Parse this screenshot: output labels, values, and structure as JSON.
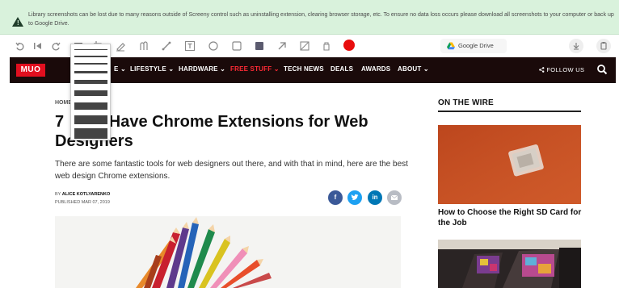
{
  "banner": {
    "message": "Library screenshots can be lost due to many reasons outside of Screeny control such as uninstalling extension, clearing browser storage, etc. To ensure no data loss occurs please download all screenshots to your computer or back up to Google Drive."
  },
  "toolbar": {
    "gdrive_label": "Google Drive",
    "color_selected": "#e80d0d"
  },
  "site": {
    "logo": "MUO",
    "nav": [
      "LIFESTYLE",
      "HARDWARE",
      "FREE STUFF",
      "TECH NEWS",
      "DEALS",
      "AWARDS",
      "ABOUT"
    ],
    "follow": "FOLLOW US"
  },
  "article": {
    "breadcrumb": "HOME",
    "title_left": "7",
    "title_right": "-Have Chrome Extensions for Web",
    "title_line2": "Designers",
    "dek": "There are some fantastic tools for web designers out there, and with that in mind, here are the best web design Chrome extensions.",
    "by_prefix": "BY",
    "author": "ALICE KOTLYARENKO",
    "published_prefix": "PUBLISHED",
    "date": "MAR 07, 2019"
  },
  "sidebar": {
    "heading": "ON THE WIRE",
    "card1_title": "How to Choose the Right SD Card for the Job"
  }
}
